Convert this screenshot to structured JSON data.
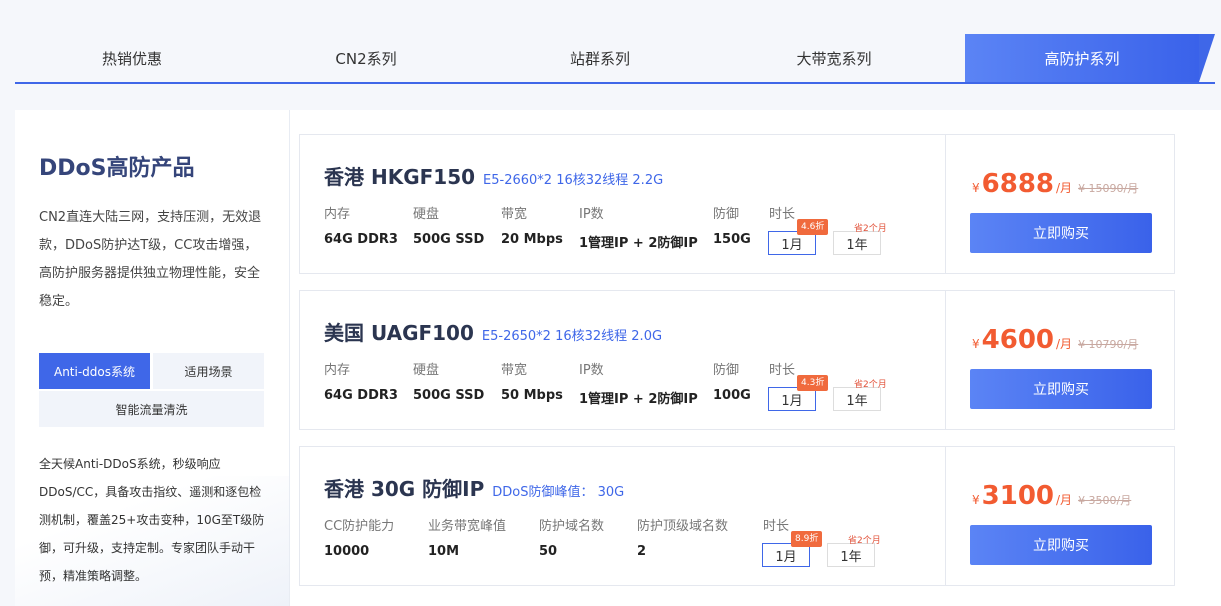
{
  "tabs": [
    "热销优惠",
    "CN2系列",
    "站群系列",
    "大带宽系列",
    "高防护系列"
  ],
  "side": {
    "title": "DDoS高防产品",
    "desc": "CN2直连大陆三网，支持压测，无效退款，DDoS防护达T级，CC攻击增强，高防护服务器提供独立物理性能，安全稳定。",
    "tabs": [
      "Anti-ddos系统",
      "适用场景",
      "智能流量清洗"
    ],
    "note": "全天候Anti-DDoS系统，秒级响应DDoS/CC，具备攻击指纹、遥测和逐包检测机制，覆盖25+攻击变种，10G至T级防御，可升级，支持定制。专家团队手动干预，精准策略调整。"
  },
  "products": [
    {
      "name": "香港 HKGF150",
      "cpu": "E5-2660*2 16核32线程 2.2G",
      "specs": [
        {
          "label": "内存",
          "value": "64G DDR3"
        },
        {
          "label": "硬盘",
          "value": "500G SSD"
        },
        {
          "label": "带宽",
          "value": "20 Mbps"
        },
        {
          "label": "IP数",
          "value": "1管理IP + 2防御IP"
        },
        {
          "label": "防御",
          "value": "150G"
        }
      ],
      "duration_label": "时长",
      "durations": [
        "1月",
        "1年"
      ],
      "discount": "4.6折",
      "save": "省2个月",
      "yen": "¥",
      "price": "6888",
      "per": "/月",
      "orig": "¥ 15090/月",
      "buy": "立即购买"
    },
    {
      "name": "美国 UAGF100",
      "cpu": "E5-2650*2 16核32线程 2.0G",
      "specs": [
        {
          "label": "内存",
          "value": "64G DDR3"
        },
        {
          "label": "硬盘",
          "value": "500G SSD"
        },
        {
          "label": "带宽",
          "value": "50 Mbps"
        },
        {
          "label": "IP数",
          "value": "1管理IP + 2防御IP"
        },
        {
          "label": "防御",
          "value": "100G"
        }
      ],
      "duration_label": "时长",
      "durations": [
        "1月",
        "1年"
      ],
      "discount": "4.3折",
      "save": "省2个月",
      "yen": "¥",
      "price": "4600",
      "per": "/月",
      "orig": "¥ 10790/月",
      "buy": "立即购买"
    },
    {
      "name": "香港 30G 防御IP",
      "cpu": "DDoS防御峰值： 30G",
      "specs": [
        {
          "label": "CC防护能力",
          "value": "10000"
        },
        {
          "label": "业务带宽峰值",
          "value": "10M"
        },
        {
          "label": "防护域名数",
          "value": "50"
        },
        {
          "label": "防护顶级域名数",
          "value": "2"
        }
      ],
      "duration_label": "时长",
      "durations": [
        "1月",
        "1年"
      ],
      "discount": "8.9折",
      "save": "省2个月",
      "yen": "¥",
      "price": "3100",
      "per": "/月",
      "orig": "¥ 3500/月",
      "buy": "立即购买"
    }
  ]
}
